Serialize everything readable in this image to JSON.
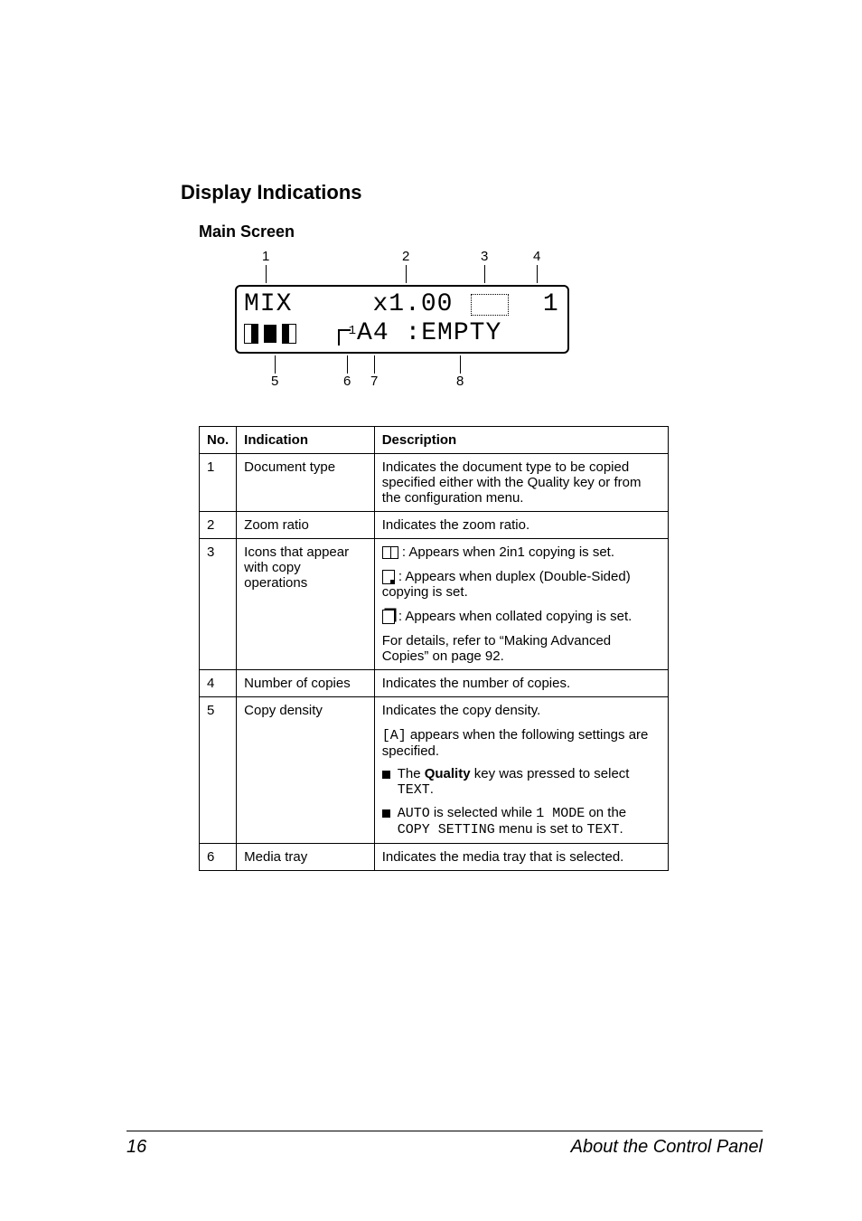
{
  "headings": {
    "section": "Display Indications",
    "sub": "Main Screen"
  },
  "lcd": {
    "callouts_top": [
      "1",
      "2",
      "3",
      "4"
    ],
    "callouts_bottom": [
      "5",
      "6",
      "7",
      "8"
    ],
    "line1_mode": "MIX",
    "line1_zoom": "x1.00",
    "line1_copies": "1",
    "line2_tray_sup": "1",
    "line2_tray_size": "A4",
    "line2_status": ":EMPTY"
  },
  "table": {
    "headers": {
      "no": "No.",
      "indication": "Indication",
      "description": "Description"
    },
    "rows": [
      {
        "no": "1",
        "indication": "Document type",
        "description": "Indicates the document type to be copied specified either with the Quality key or from the configuration menu."
      },
      {
        "no": "2",
        "indication": "Zoom ratio",
        "description": "Indicates the zoom ratio."
      },
      {
        "no": "3",
        "indication": "Icons that appear with copy operations",
        "d_2in1": ": Appears when 2in1 copying is set.",
        "d_duplex": ": Appears when duplex (Double-Sided) copying is set.",
        "d_collate": ": Appears when collated copying is set.",
        "d_ref": "For details, refer to “Making Advanced Copies” on page 92."
      },
      {
        "no": "4",
        "indication": "Number of copies",
        "description": "Indicates the number of copies."
      },
      {
        "no": "5",
        "indication": "Copy density",
        "d_intro": "Indicates the copy density.",
        "d_a_pre": "[A]",
        "d_a_post": " appears when the following settings are specified.",
        "b1_pre": "The ",
        "b1_bold": "Quality",
        "b1_mid": " key was pressed to select ",
        "b1_mono": "TEXT",
        "b1_post": ".",
        "b2_mono1": "AUTO",
        "b2_mid1": " is selected while ",
        "b2_mono2": "1 MODE",
        "b2_mid2": " on the ",
        "b2_mono3": "COPY SETTING",
        "b2_mid3": " menu is set to ",
        "b2_mono4": "TEXT",
        "b2_post": "."
      },
      {
        "no": "6",
        "indication": "Media tray",
        "description": "Indicates the media tray that is selected."
      }
    ]
  },
  "footer": {
    "page": "16",
    "title": "About the Control Panel"
  }
}
